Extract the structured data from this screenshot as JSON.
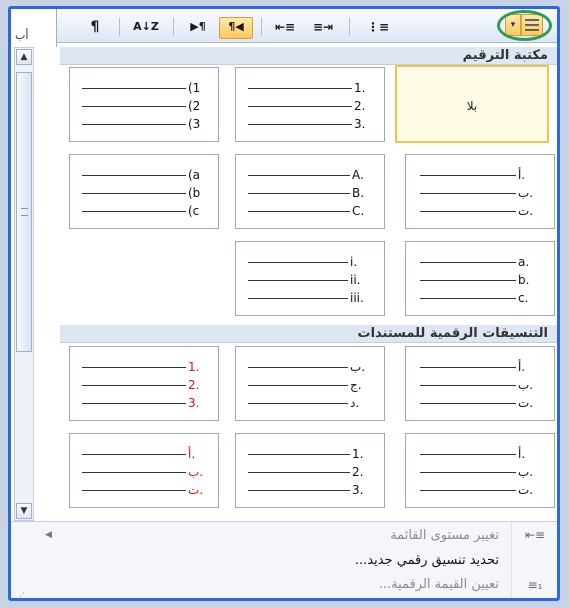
{
  "toolbar": {
    "doc_edge_text": "أب",
    "pilcrow": "¶",
    "sort": "A↓Z",
    "ltr": "▶¶",
    "rtl": "¶◀",
    "indent_decrease": "⇤≡",
    "indent_increase": "≡⇥",
    "multilevel": "⋮≡",
    "dropdown_arrow": "▾",
    "numbering": "≡"
  },
  "library_section": {
    "title": "مكتبة الترقيم"
  },
  "document_section": {
    "title": "التنسيقات الرقمية للمستندات"
  },
  "tiles": {
    "none_label": "بلا",
    "t_123": [
      "1.",
      "2.",
      "3."
    ],
    "t_paren123": [
      "(1",
      "(2",
      "(3"
    ],
    "t_arabic_letters": [
      "أ.",
      "ب.",
      "ت."
    ],
    "t_ABC": [
      "A.",
      "B.",
      "C."
    ],
    "t_paren_abc": [
      "(a",
      "(b",
      "(c"
    ],
    "t_abc": [
      "a.",
      "b.",
      "c."
    ],
    "t_roman": [
      "i.",
      "ii.",
      "iii."
    ],
    "d_arabic1": [
      "أ.",
      "ب.",
      "ت."
    ],
    "d_abjad": [
      "ب.",
      "ج.",
      "د."
    ],
    "d_red123": [
      "1.",
      "2.",
      "3."
    ],
    "d_arabic2": [
      "أ.",
      "ب.",
      "ت."
    ],
    "d_123": [
      "1.",
      "2.",
      "3."
    ],
    "d_red_arabic": [
      "أ.",
      "ب.",
      "ت."
    ]
  },
  "menu": {
    "change_level": "تغيير مستوى القائمة",
    "define_new": "تحديد تنسيق رقمي جديد...",
    "set_value": "تعيين القيمة الرقمية..."
  },
  "colors": {
    "frame_border": "#2f66e6",
    "highlight": "#ffc95a",
    "red_number": "#dd1111",
    "annotation_circle": "#2f9a5a"
  }
}
